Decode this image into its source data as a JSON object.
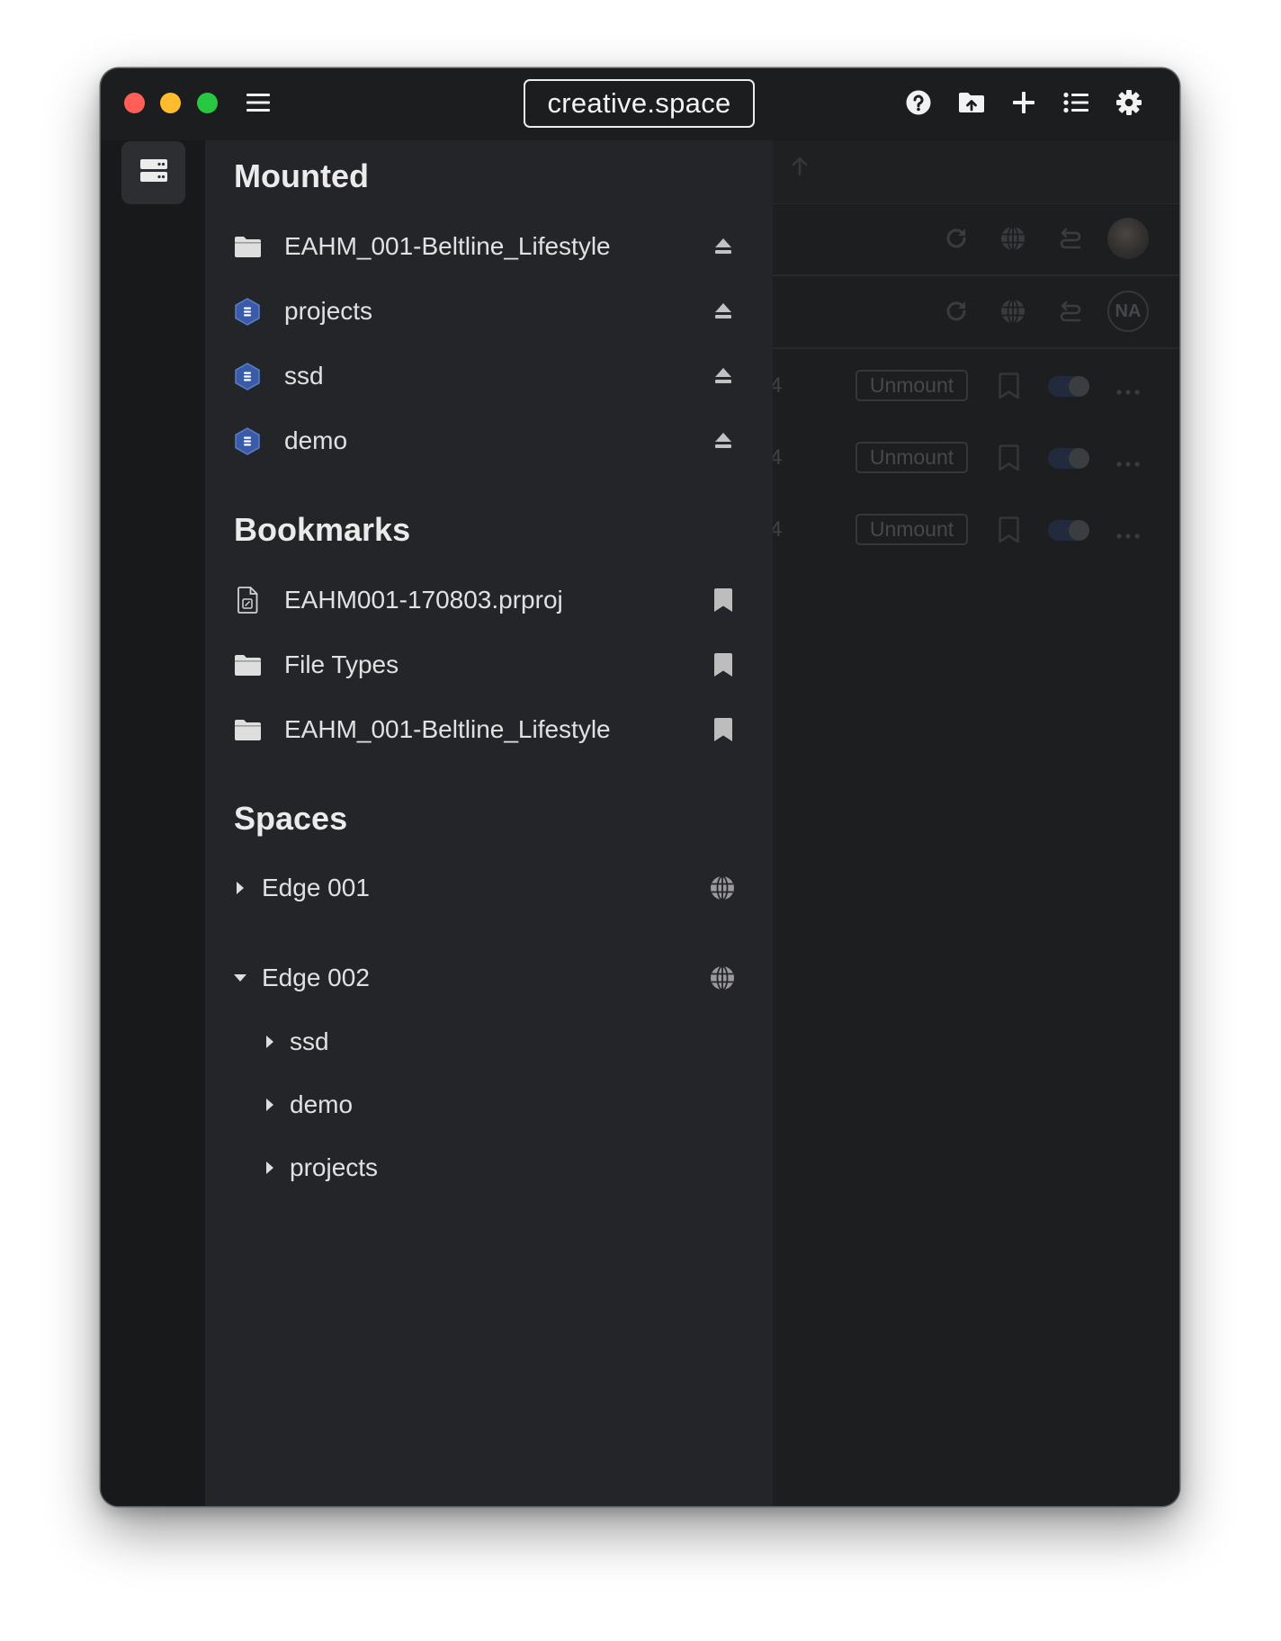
{
  "window": {
    "title": "creative.space"
  },
  "titlebar": {
    "traffic_lights": {
      "close": "#ff5f57",
      "minimize": "#febc2e",
      "maximize": "#28c840"
    },
    "menu_icon": "hamburger-icon",
    "actions": [
      "help-icon",
      "upload-folder-icon",
      "plus-icon",
      "list-icon",
      "gear-icon"
    ]
  },
  "rail": {
    "active_item_icon": "server-icon"
  },
  "sidebar": {
    "mounted": {
      "heading": "Mounted",
      "items": [
        {
          "label": "EAHM_001-Beltline_Lifestyle",
          "icon": "folder-icon",
          "action_icon": "eject-icon"
        },
        {
          "label": "projects",
          "icon": "volume-hex-icon",
          "action_icon": "eject-icon"
        },
        {
          "label": "ssd",
          "icon": "volume-hex-icon",
          "action_icon": "eject-icon"
        },
        {
          "label": "demo",
          "icon": "volume-hex-icon",
          "action_icon": "eject-icon"
        }
      ]
    },
    "bookmarks": {
      "heading": "Bookmarks",
      "items": [
        {
          "label": "EAHM001-170803.prproj",
          "icon": "project-file-icon",
          "action_icon": "bookmark-icon"
        },
        {
          "label": "File Types",
          "icon": "folder-icon",
          "action_icon": "bookmark-icon"
        },
        {
          "label": "EAHM_001-Beltline_Lifestyle",
          "icon": "folder-icon",
          "action_icon": "bookmark-icon"
        }
      ]
    },
    "spaces": {
      "heading": "Spaces",
      "items": [
        {
          "label": "Edge 001",
          "expanded": false,
          "action_icon": "globe-icon",
          "children": []
        },
        {
          "label": "Edge 002",
          "expanded": true,
          "action_icon": "globe-icon",
          "children": [
            {
              "label": "ssd"
            },
            {
              "label": "demo"
            },
            {
              "label": "projects"
            }
          ]
        }
      ]
    }
  },
  "main": {
    "header_icon": "arrow-up-icon",
    "servers": [
      {
        "avatar": "user-photo",
        "icons": [
          "refresh-icon",
          "globe-icon",
          "transfer-icon"
        ]
      },
      {
        "avatar_initials": "NA",
        "icons": [
          "refresh-icon",
          "globe-icon",
          "transfer-icon"
        ]
      }
    ],
    "volumes": [
      {
        "clipped_text": "4",
        "unmount_label": "Unmount",
        "bookmarked": false,
        "enabled": true
      },
      {
        "clipped_text": "4",
        "unmount_label": "Unmount",
        "bookmarked": false,
        "enabled": true
      },
      {
        "clipped_text": "4",
        "unmount_label": "Unmount",
        "bookmarked": false,
        "enabled": true
      }
    ]
  },
  "colors": {
    "window_bg": "#1c1d1f",
    "rail_bg": "#18191b",
    "sidebar_bg": "#242528",
    "main_bg": "#1d1e20",
    "volume_icon": "#3a5ca8",
    "text": "#e1e1e1"
  }
}
